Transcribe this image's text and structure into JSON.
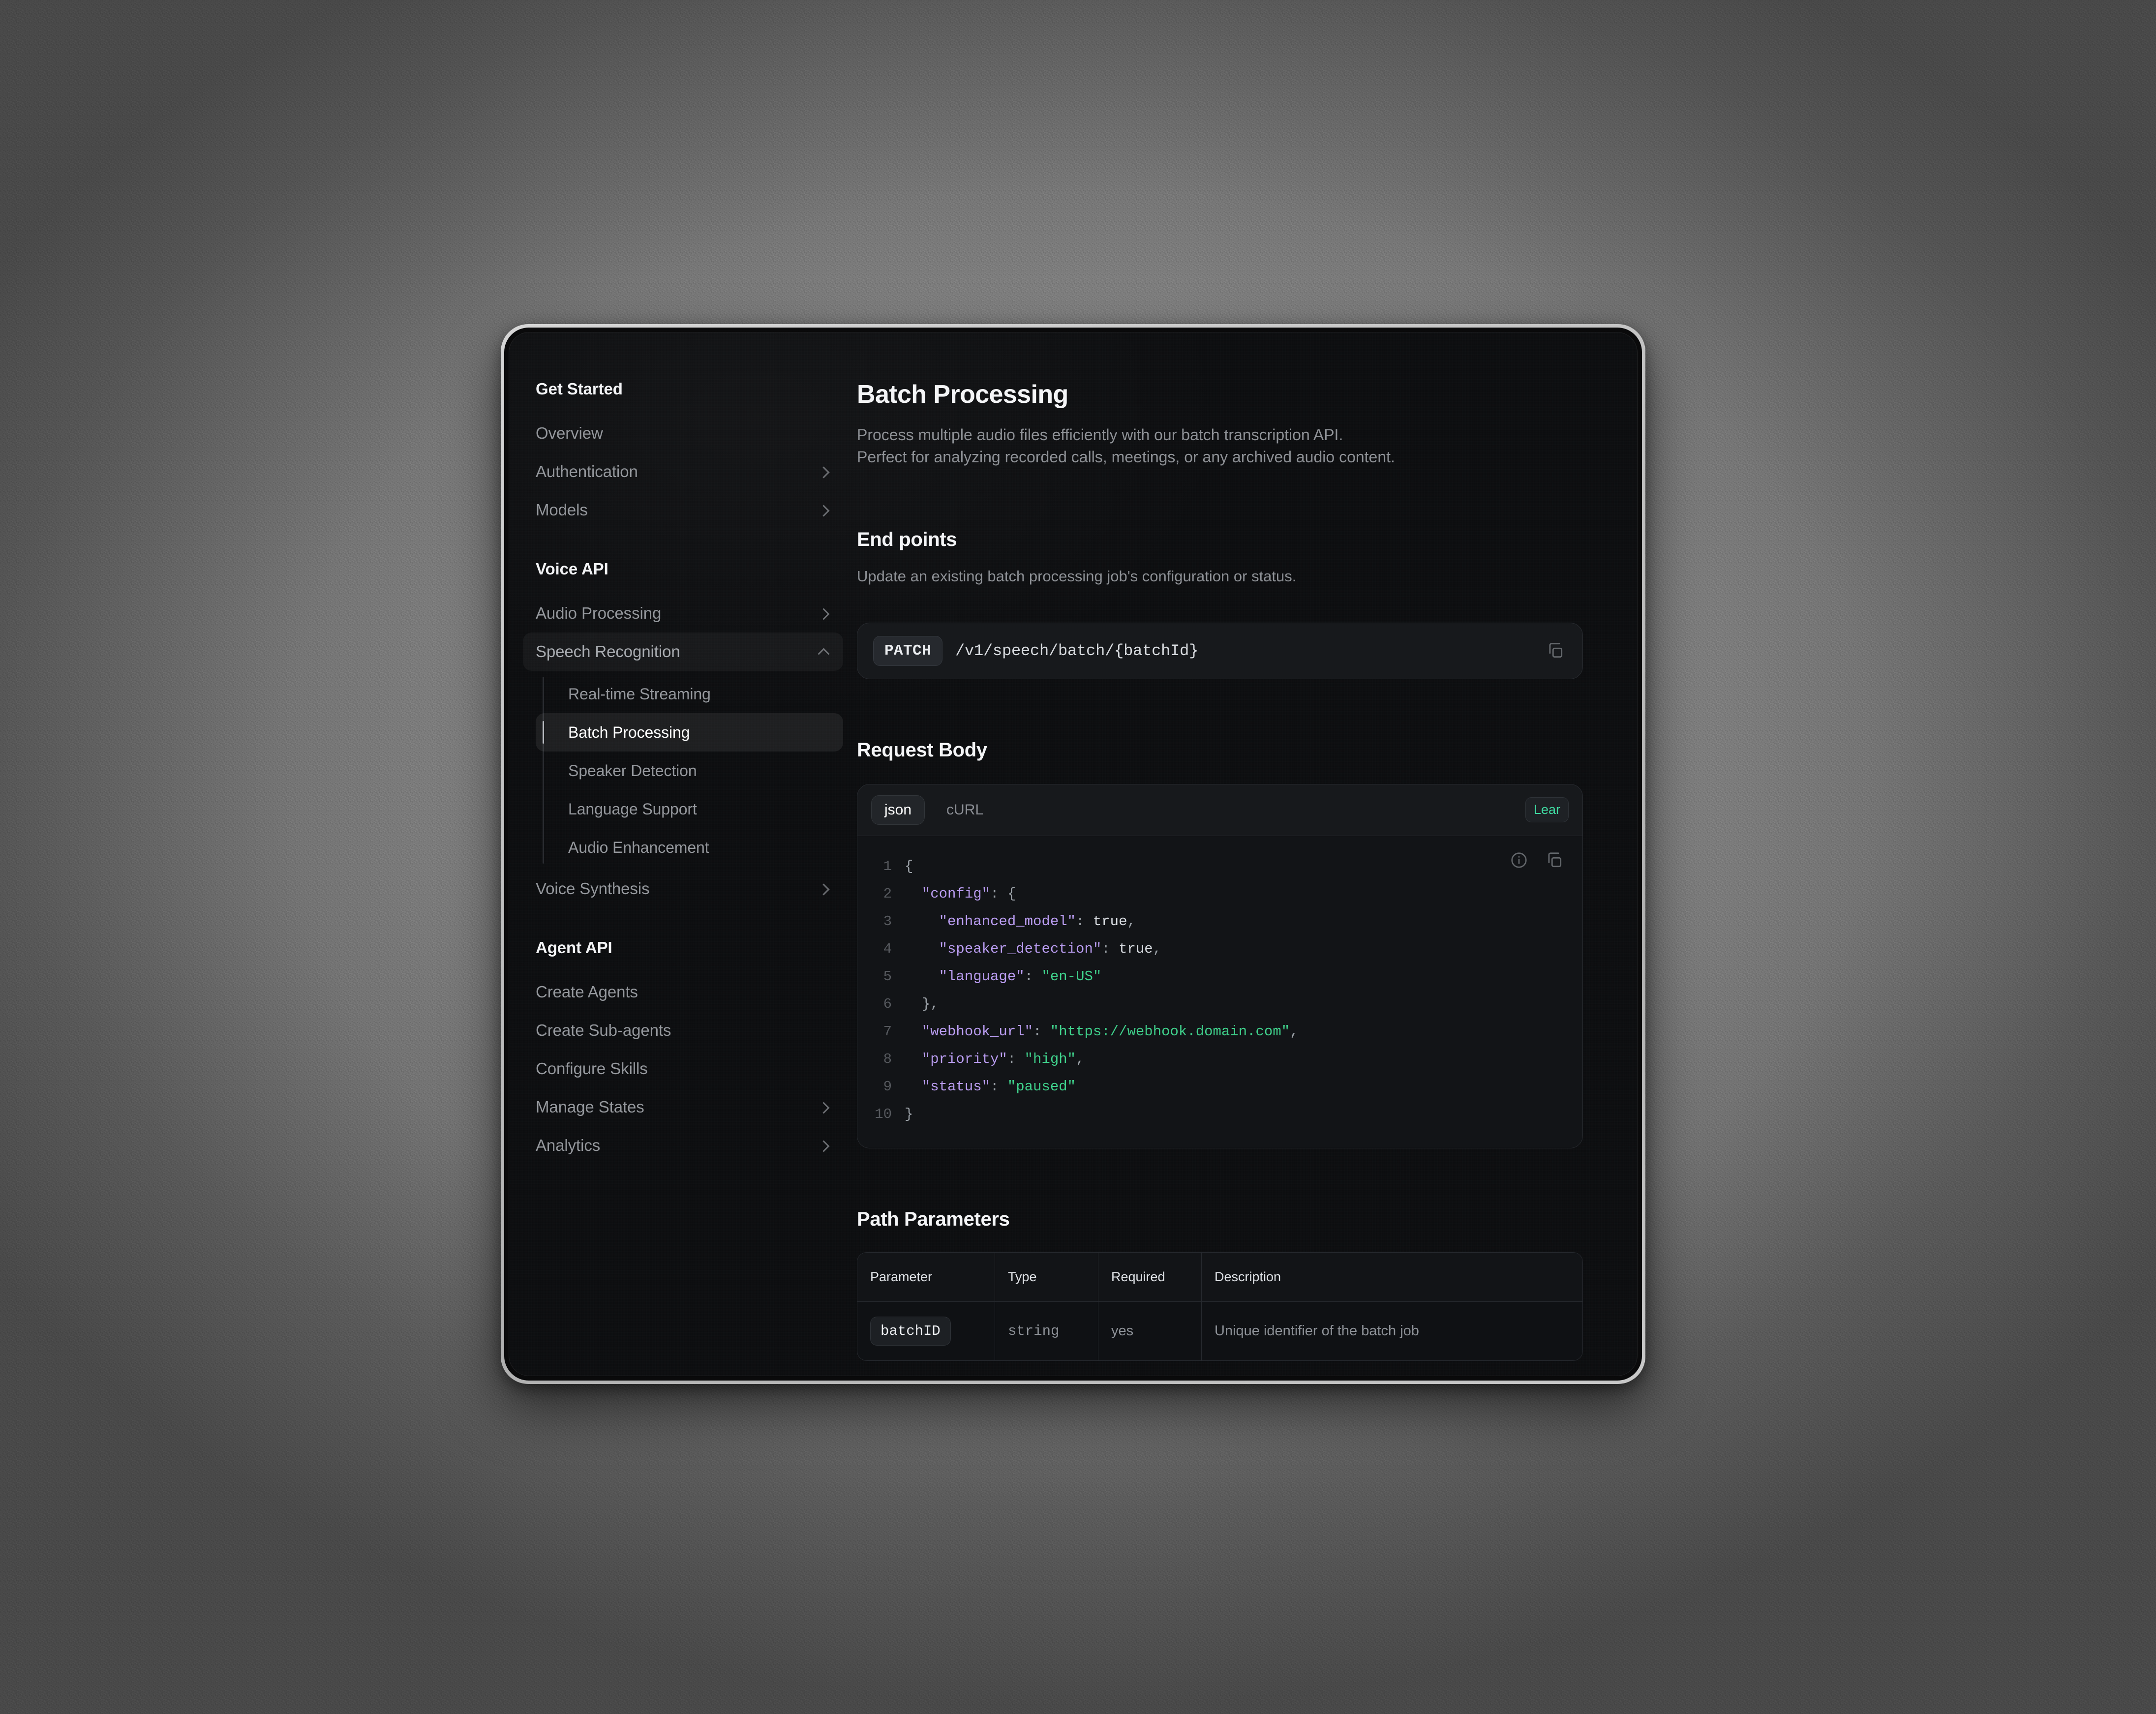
{
  "sidebar": {
    "sections": [
      {
        "title": "Get Started",
        "items": [
          {
            "label": "Overview",
            "chevron": "none"
          },
          {
            "label": "Authentication",
            "chevron": "chevron-right-icon"
          },
          {
            "label": "Models",
            "chevron": "chevron-right-icon"
          }
        ]
      },
      {
        "title": "Voice API",
        "items": [
          {
            "label": "Audio Processing",
            "chevron": "chevron-right-icon"
          },
          {
            "label": "Speech Recognition",
            "chevron": "chevron-up-icon",
            "expanded": true
          },
          {
            "label": "Voice Synthesis",
            "chevron": "chevron-right-icon"
          }
        ],
        "sub_items": [
          {
            "label": "Real-time Streaming",
            "active": false
          },
          {
            "label": "Batch Processing",
            "active": true
          },
          {
            "label": "Speaker Detection",
            "active": false
          },
          {
            "label": "Language Support",
            "active": false
          },
          {
            "label": "Audio Enhancement",
            "active": false
          }
        ]
      },
      {
        "title": "Agent API",
        "items": [
          {
            "label": "Create Agents",
            "chevron": "none"
          },
          {
            "label": "Create Sub-agents",
            "chevron": "none"
          },
          {
            "label": "Configure Skills",
            "chevron": "none"
          },
          {
            "label": "Manage States",
            "chevron": "chevron-right-icon"
          },
          {
            "label": "Analytics",
            "chevron": "chevron-right-icon"
          }
        ]
      }
    ]
  },
  "main": {
    "title": "Batch Processing",
    "subtitle_line1": "Process multiple audio files efficiently with our batch transcription API.",
    "subtitle_line2": "Perfect for analyzing recorded calls, meetings, or any archived audio content.",
    "endpoints_heading": "End points",
    "endpoints_desc": "Update an existing batch processing job's configuration or status.",
    "endpoint": {
      "method": "PATCH",
      "path": "/v1/speech/batch/{batchId}",
      "copy_icon": "copy-icon"
    },
    "request_body_heading": "Request Body",
    "code": {
      "tabs": [
        {
          "label": "json",
          "active": true
        },
        {
          "label": "cURL",
          "active": false
        }
      ],
      "badge": "Lear",
      "info_icon": "info-circle-icon",
      "copy_icon": "copy-icon",
      "lines": [
        {
          "n": "1",
          "tokens": [
            {
              "t": "pun",
              "v": "{"
            }
          ]
        },
        {
          "n": "2",
          "tokens": [
            {
              "t": "key",
              "v": "  \"config\""
            },
            {
              "t": "pun",
              "v": ": {"
            }
          ]
        },
        {
          "n": "3",
          "tokens": [
            {
              "t": "key",
              "v": "    \"enhanced_model\""
            },
            {
              "t": "pun",
              "v": ": "
            },
            {
              "t": "lit",
              "v": "true"
            },
            {
              "t": "pun",
              "v": ","
            }
          ]
        },
        {
          "n": "4",
          "tokens": [
            {
              "t": "key",
              "v": "    \"speaker_detection\""
            },
            {
              "t": "pun",
              "v": ": "
            },
            {
              "t": "lit",
              "v": "true"
            },
            {
              "t": "pun",
              "v": ","
            }
          ]
        },
        {
          "n": "5",
          "tokens": [
            {
              "t": "key",
              "v": "    \"language\""
            },
            {
              "t": "pun",
              "v": ": "
            },
            {
              "t": "str",
              "v": "\"en-US\""
            }
          ]
        },
        {
          "n": "6",
          "tokens": [
            {
              "t": "pun",
              "v": "  },"
            }
          ]
        },
        {
          "n": "7",
          "tokens": [
            {
              "t": "key",
              "v": "  \"webhook_url\""
            },
            {
              "t": "pun",
              "v": ": "
            },
            {
              "t": "str",
              "v": "\"https://webhook.domain.com\""
            },
            {
              "t": "pun",
              "v": ","
            }
          ]
        },
        {
          "n": "8",
          "tokens": [
            {
              "t": "key",
              "v": "  \"priority\""
            },
            {
              "t": "pun",
              "v": ": "
            },
            {
              "t": "str",
              "v": "\"high\""
            },
            {
              "t": "pun",
              "v": ","
            }
          ]
        },
        {
          "n": "9",
          "tokens": [
            {
              "t": "key",
              "v": "  \"status\""
            },
            {
              "t": "pun",
              "v": ": "
            },
            {
              "t": "str",
              "v": "\"paused\""
            }
          ]
        },
        {
          "n": "10",
          "tokens": [
            {
              "t": "pun",
              "v": "}"
            }
          ]
        }
      ]
    },
    "path_params_heading": "Path Parameters",
    "table": {
      "headers": [
        "Parameter",
        "Type",
        "Required",
        "Description"
      ],
      "rows": [
        {
          "parameter": "batchID",
          "type": "string",
          "required": "yes",
          "description": "Unique identifier of the batch job"
        }
      ]
    }
  },
  "colors": {
    "accent_green": "#3fd9a0",
    "key_purple": "#b99cf0",
    "string_green": "#3fd08b",
    "panel_bg": "#0c0d0f",
    "card_bg": "#17191c"
  }
}
